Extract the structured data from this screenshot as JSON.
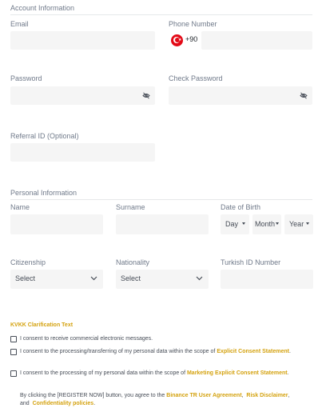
{
  "account": {
    "section_title": "Account Information",
    "email_label": "Email",
    "phone_label": "Phone Number",
    "phone_dial_code": "+90",
    "country_flag_icon": "turkey-flag-icon",
    "password_label": "Password",
    "check_password_label": "Check Password",
    "password_toggle_icon": "eye-off-icon",
    "referral_label": "Referral ID (Optional)"
  },
  "personal": {
    "section_title": "Personal Information",
    "name_label": "Name",
    "surname_label": "Surname",
    "dob_label": "Date of Birth",
    "dob_day": "Day",
    "dob_month": "Month",
    "dob_year": "Year",
    "citizenship_label": "Citizenship",
    "citizenship_value": "Select",
    "nationality_label": "Nationality",
    "nationality_value": "Select",
    "turkish_id_label": "Turkish ID Number"
  },
  "consents": {
    "kvkk_link": "KVKK Clarification Text",
    "consent1": "I consent to receive commercial electronic messages.",
    "consent2_prefix": "I consent to the processing/transferring of my personal data within the scope of",
    "consent2_link": "Explicit Consent Statement",
    "consent3_prefix": "I consent to the processing of my personal data within the scope of",
    "consent3_link": "Marketing Explicit Consent Statement",
    "agreement_prefix": "By clicking the [REGISTER NOW] button, you agree to the",
    "agreement_link1": "Binance TR User Agreement",
    "agreement_link2": "Risk Disclaimer",
    "agreement_and": "and",
    "agreement_link3": "Confidentiality policies"
  },
  "colors": {
    "accent": "#d4a20f",
    "field_bg": "#f5f5f5",
    "label": "#707a8a",
    "text": "#474d57"
  }
}
